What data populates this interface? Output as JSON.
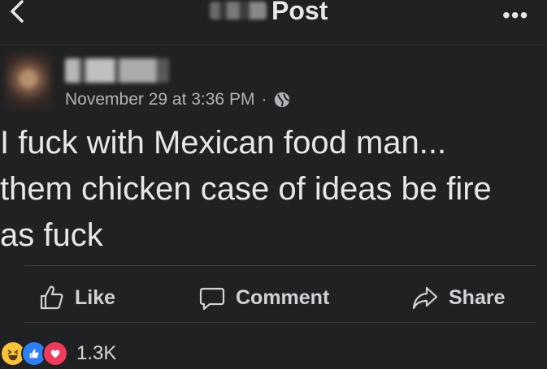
{
  "header": {
    "back_icon": "back-chevron-icon",
    "title": "Post",
    "more_icon": "more-dots-icon",
    "more_label": "•••"
  },
  "post": {
    "timestamp": "November 29 at 3:36 PM",
    "separator": "·",
    "privacy_icon": "globe-icon",
    "text": "I fuck with Mexican food man...\nthem chicken case of ideas be fire\nas fuck"
  },
  "actions": {
    "like": "Like",
    "comment": "Comment",
    "share": "Share"
  },
  "reactions": {
    "icons": [
      "haha-icon",
      "like-icon",
      "love-icon"
    ],
    "count": "1.3K"
  },
  "colors": {
    "background": "#202123",
    "text": "#e4e6eb",
    "muted": "#b0b3b8",
    "like_blue": "#2d7ff9",
    "love_red": "#f23b5a",
    "haha_yellow": "#f7c338"
  }
}
